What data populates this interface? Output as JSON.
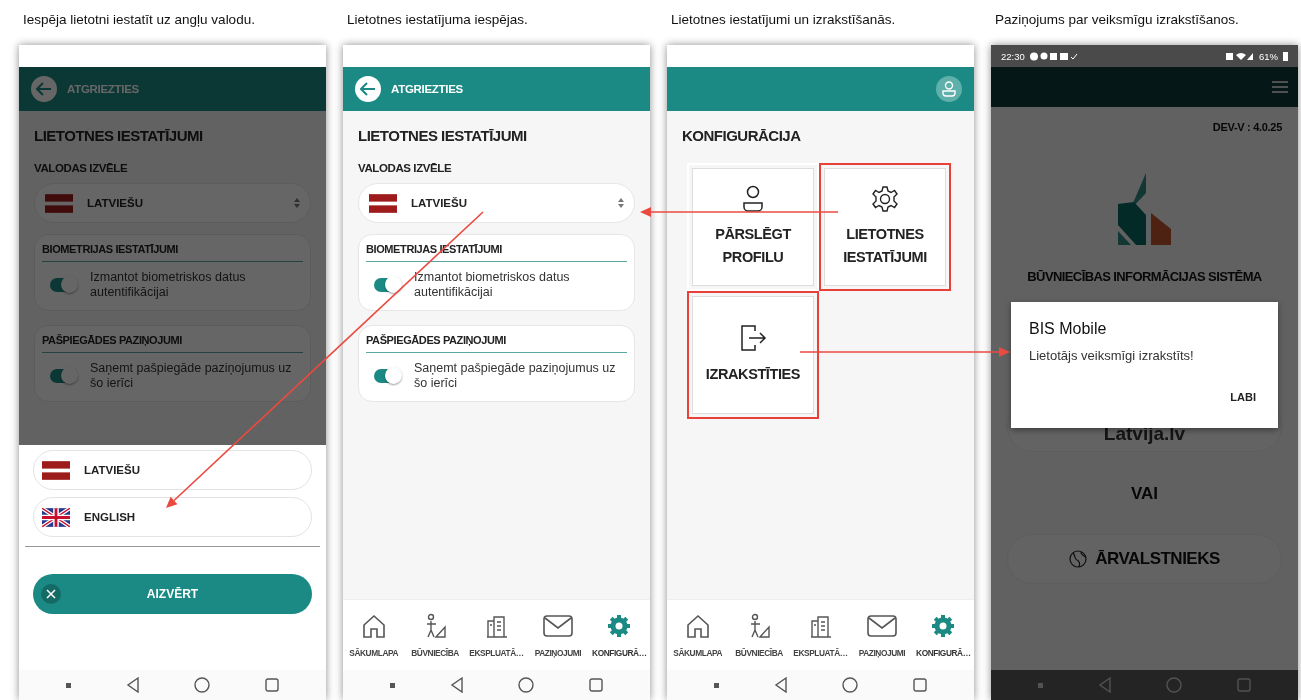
{
  "screens": [
    {
      "kind": "settings",
      "caption": "Iespēja lietotni iestatīt uz angļu valodu.",
      "dimmed": true,
      "back_label": "ATGRIEZTIES",
      "title": "LIETOTNES IESTATĪJUMI",
      "language_label": "VALODAS IZVĒLE",
      "language_value": "LATVIEŠU",
      "sections": [
        {
          "title": "BIOMETRIJAS IESTATĪJUMI",
          "toggle_label": "Izmantot biometriskos datus autentifikācijai",
          "on": true
        },
        {
          "title": "PAŠPIEGĀDES PAZIŅOJUMI",
          "toggle_label": "Saņemt pašpiegāde paziņojumus uz šo ierīci",
          "on": true
        }
      ],
      "language_sheet": {
        "options": [
          "LATVIEŠU",
          "ENGLISH"
        ],
        "close_label": "AIZVĒRT"
      }
    },
    {
      "kind": "settings",
      "caption": "Lietotnes iestatījuma iespējas.",
      "dimmed": false,
      "back_label": "ATGRIEZTIES",
      "title": "LIETOTNES IESTATĪJUMI",
      "language_label": "VALODAS IZVĒLE",
      "language_value": "LATVIEŠU",
      "sections": [
        {
          "title": "BIOMETRIJAS IESTATĪJUMI",
          "toggle_label": "Izmantot biometriskos datus autentifikācijai",
          "on": true
        },
        {
          "title": "PAŠPIEGĀDES PAZIŅOJUMI",
          "toggle_label": "Saņemt pašpiegāde paziņojumus uz šo ierīci",
          "on": true
        }
      ],
      "nav": [
        {
          "label": "SĀKUMLAPA",
          "selected": false
        },
        {
          "label": "BŪVNIECĪBA",
          "selected": false
        },
        {
          "label": "EKSPLUATĀ…",
          "selected": false
        },
        {
          "label": "PAZIŅOJUMI",
          "selected": false
        },
        {
          "label": "KONFIGURĀ…",
          "selected": true
        }
      ]
    },
    {
      "kind": "menu",
      "caption": "Lietotnes iestatījumi un izrakstīšanās.",
      "dimmed": false,
      "title": "KONFIGURĀCIJA",
      "tiles": [
        {
          "label": "PĀRSLĒGT PROFILU",
          "highlighted": false
        },
        {
          "label": "LIETOTNES IESTATĪJUMI",
          "highlighted": true
        },
        {
          "label": "IZRAKSTĪTIES",
          "highlighted": true
        }
      ],
      "nav": [
        {
          "label": "SĀKUMLAPA",
          "selected": false
        },
        {
          "label": "BŪVNIECĪBA",
          "selected": false
        },
        {
          "label": "EKSPLUATĀ…",
          "selected": false
        },
        {
          "label": "PAZIŅOJUMI",
          "selected": false
        },
        {
          "label": "KONFIGURĀ…",
          "selected": true
        }
      ]
    },
    {
      "kind": "login",
      "caption": "Paziņojums par veiksmīgu izrakstīšanos.",
      "dimmed": true,
      "status_bar": {
        "time": "22:30",
        "battery": "61%"
      },
      "version": "DEV-V : 4.0.25",
      "system_title": "BŪVNIECĪBAS INFORMĀCIJAS SISTĒMA",
      "latvija_label": "Latvija.lv",
      "or_label": "VAI",
      "foreigner_label": "ĀRVALSTNIEKS",
      "dialog": {
        "title": "BIS Mobile",
        "message": "Lietotājs veiksmīgi izrakstīts!",
        "button": "LABI"
      }
    }
  ]
}
